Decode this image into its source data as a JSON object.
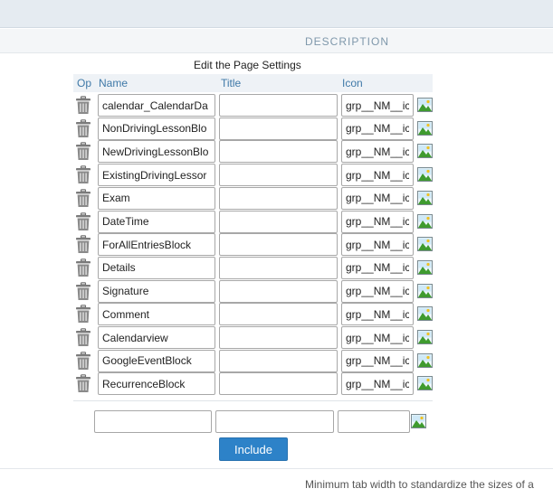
{
  "header": {
    "description_label": "DESCRIPTION"
  },
  "panel": {
    "title": "Edit the Page Settings",
    "columns": {
      "op": "Op",
      "name": "Name",
      "title": "Title",
      "icon": "Icon"
    },
    "rows": [
      {
        "name": "calendar_CalendarDa",
        "title": "",
        "icon": "grp__NM__ic"
      },
      {
        "name": "NonDrivingLessonBlo",
        "title": "",
        "icon": "grp__NM__ic"
      },
      {
        "name": "NewDrivingLessonBlo",
        "title": "",
        "icon": "grp__NM__ic"
      },
      {
        "name": "ExistingDrivingLessor",
        "title": "",
        "icon": "grp__NM__ic"
      },
      {
        "name": "Exam",
        "title": "",
        "icon": "grp__NM__ic"
      },
      {
        "name": "DateTime",
        "title": "",
        "icon": "grp__NM__ic"
      },
      {
        "name": "ForAllEntriesBlock",
        "title": "",
        "icon": "grp__NM__ic"
      },
      {
        "name": "Details",
        "title": "",
        "icon": "grp__NM__ic"
      },
      {
        "name": "Signature",
        "title": "",
        "icon": "grp__NM__ic"
      },
      {
        "name": "Comment",
        "title": "",
        "icon": "grp__NM__ic"
      },
      {
        "name": "Calendarview",
        "title": "",
        "icon": "grp__NM__ic"
      },
      {
        "name": "GoogleEventBlock",
        "title": "",
        "icon": "grp__NM__ic"
      },
      {
        "name": "RecurrenceBlock",
        "title": "",
        "icon": "grp__NM__ic"
      }
    ],
    "new_row": {
      "name": "",
      "title": "",
      "icon": ""
    },
    "include_label": "Include"
  },
  "footer": {
    "hint_text": "Minimum tab width to standardize the sizes of a"
  },
  "icons": {
    "delete": "trash-icon",
    "image": "image-icon"
  },
  "colors": {
    "accent": "#2d82c8",
    "header_text": "#3f79a8",
    "description_label": "#7f98ab"
  }
}
